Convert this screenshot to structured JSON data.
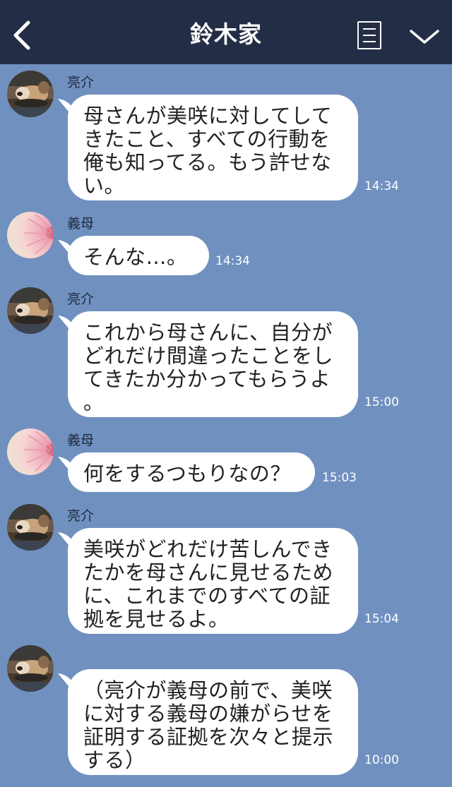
{
  "header": {
    "title": "鈴木家"
  },
  "messages": [
    {
      "sender": "亮介",
      "avatar": "dog-avatar",
      "text": "母さんが美咲に対してして\nきたこと、すべての行動を\n俺も知ってる。もう許せな\nい。",
      "time": "14:34"
    },
    {
      "sender": "義母",
      "avatar": "flower-avatar",
      "text": "そんな…。",
      "time": "14:34"
    },
    {
      "sender": "亮介",
      "avatar": "dog-avatar",
      "text": "これから母さんに、自分が\nどれだけ間違ったことをし\nてきたか分かってもらうよ\n。",
      "time": "15:00"
    },
    {
      "sender": "義母",
      "avatar": "flower-avatar",
      "text": "何をするつもりなの？",
      "time": "15:03"
    },
    {
      "sender": "亮介",
      "avatar": "dog-avatar",
      "text": "美咲がどれだけ苦しんでき\nたかを母さんに見せるため\nに、これまでのすべての証\n拠を見せるよ。",
      "time": "15:04"
    },
    {
      "sender": "",
      "avatar": "dog-avatar",
      "text": "（亮介が義母の前で、美咲\nに対する義母の嫌がらせを\n証明する証拠を次々と提示\nする）",
      "time": "10:00"
    }
  ]
}
